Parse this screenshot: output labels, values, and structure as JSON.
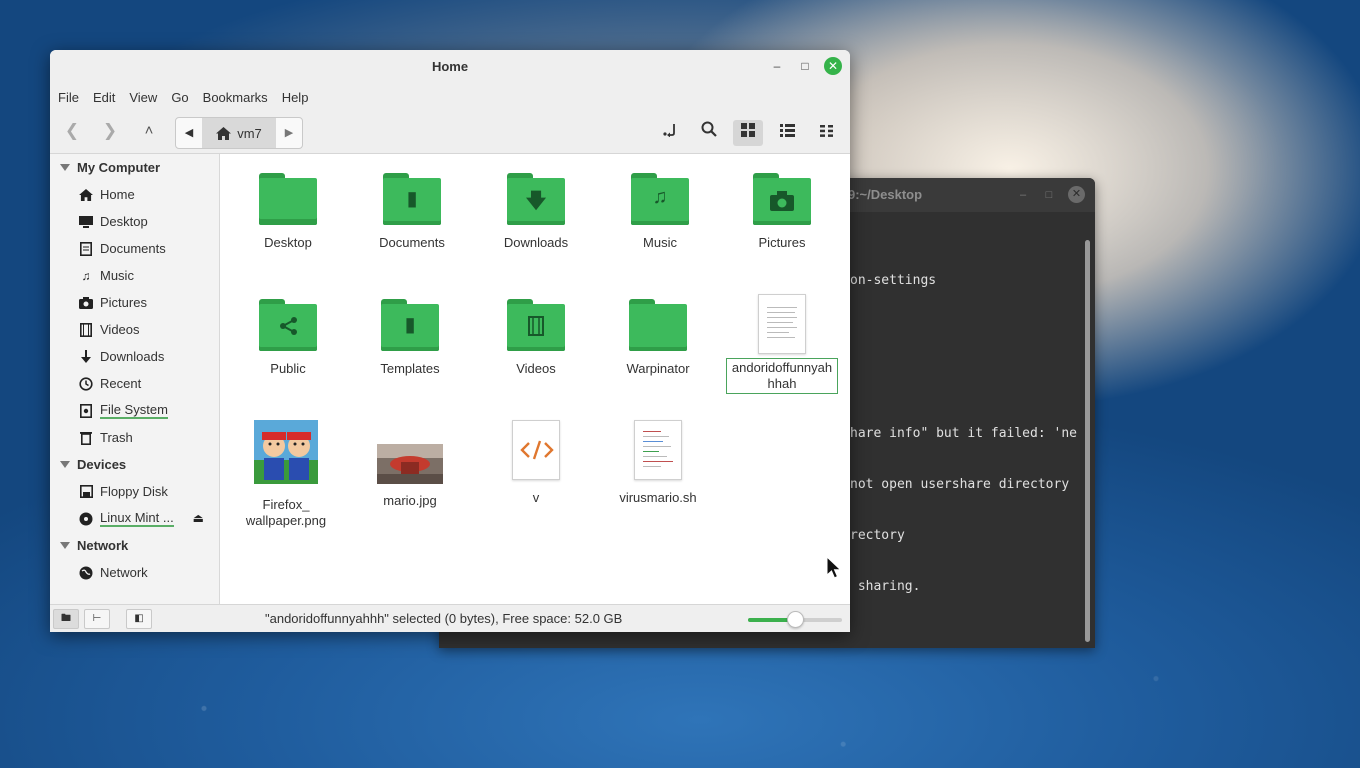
{
  "terminal": {
    "title": "9:~/Desktop",
    "lines": [
      "on-settings",
      "",
      "",
      "",
      "hare info\" but it failed: 'ne",
      "not open usershare directory",
      "rectory",
      " sharing."
    ]
  },
  "window": {
    "title": "Home",
    "minimize": "–",
    "maximize": "□",
    "close": "✕"
  },
  "menu": [
    "File",
    "Edit",
    "View",
    "Go",
    "Bookmarks",
    "Help"
  ],
  "toolbar": {
    "path_current": "vm7",
    "icons": [
      "back-icon",
      "forward-icon",
      "up-icon",
      "toggle-location-icon",
      "search-icon",
      "icon-view-icon",
      "list-view-icon",
      "compact-view-icon"
    ]
  },
  "sidebar": {
    "sections": [
      {
        "title": "My Computer",
        "items": [
          {
            "label": "Home",
            "icon": "home-icon"
          },
          {
            "label": "Desktop",
            "icon": "desktop-icon"
          },
          {
            "label": "Documents",
            "icon": "documents-icon"
          },
          {
            "label": "Music",
            "icon": "music-icon"
          },
          {
            "label": "Pictures",
            "icon": "pictures-icon"
          },
          {
            "label": "Videos",
            "icon": "videos-icon"
          },
          {
            "label": "Downloads",
            "icon": "downloads-icon"
          },
          {
            "label": "Recent",
            "icon": "recent-icon"
          },
          {
            "label": "File System",
            "icon": "filesystem-icon"
          },
          {
            "label": "Trash",
            "icon": "trash-icon"
          }
        ]
      },
      {
        "title": "Devices",
        "items": [
          {
            "label": "Floppy Disk",
            "icon": "floppy-icon"
          },
          {
            "label": "Linux Mint ...",
            "icon": "disc-icon"
          }
        ]
      },
      {
        "title": "Network",
        "items": [
          {
            "label": "Network",
            "icon": "network-icon"
          }
        ]
      }
    ]
  },
  "files": [
    {
      "name": "Desktop",
      "kind": "folder"
    },
    {
      "name": "Documents",
      "kind": "folder"
    },
    {
      "name": "Downloads",
      "kind": "folder"
    },
    {
      "name": "Music",
      "kind": "folder"
    },
    {
      "name": "Pictures",
      "kind": "folder"
    },
    {
      "name": "Public",
      "kind": "folder"
    },
    {
      "name": "Templates",
      "kind": "folder"
    },
    {
      "name": "Videos",
      "kind": "folder"
    },
    {
      "name": "Warpinator",
      "kind": "folder"
    },
    {
      "name": "andoridoffunnyahhhah",
      "kind": "document",
      "renaming": true
    },
    {
      "name": "Firefox_\nwallpaper.png",
      "kind": "image"
    },
    {
      "name": "mario.jpg",
      "kind": "image"
    },
    {
      "name": "v",
      "kind": "html"
    },
    {
      "name": "virusmario.sh",
      "kind": "script"
    }
  ],
  "status": {
    "text": "\"andoridoffunnyahhh\" selected (0 bytes), Free space: 52.0 GB",
    "zoom_fraction": 0.5
  },
  "colors": {
    "accent": "#3dba5c",
    "close_button": "#35b34a"
  }
}
